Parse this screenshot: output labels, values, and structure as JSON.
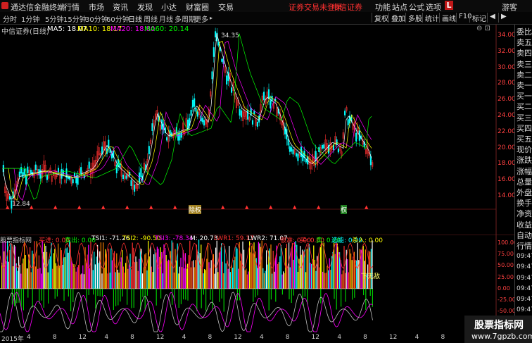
{
  "titlebar": {
    "app_name": "通达信金融终端",
    "menus": [
      "行情",
      "市场",
      "资讯",
      "发现",
      "小达",
      "财富圈",
      "交易"
    ],
    "notice": "证券交易未登录",
    "broker": "中信证券",
    "right_menus": [
      "功能",
      "站点",
      "公式",
      "选项"
    ],
    "l_badge": "L",
    "guest": "游客"
  },
  "periodbar": {
    "periods": [
      "分时",
      "1分钟",
      "5分钟",
      "15分钟",
      "30分钟",
      "60分钟",
      "日线",
      "周线",
      "月线",
      "多周期",
      "更多"
    ],
    "active": "日线",
    "right_buttons": [
      "复权",
      "叠加",
      "多股",
      "统计",
      "画线",
      "F10",
      "标记"
    ]
  },
  "chart": {
    "title": "中信证券(日线)",
    "ma": [
      {
        "label": "MA5: 18.07",
        "color": "#ffffff"
      },
      {
        "label": "MA10: 18.17",
        "color": "#ffff00"
      },
      {
        "label": "MA20: 18.80",
        "color": "#ff00ff"
      },
      {
        "label": "MA60: 20.14",
        "color": "#00ff00"
      }
    ],
    "high_label": "34.35",
    "low_label": "12.84",
    "yticks": [
      "34.00",
      "32.00",
      "30.00",
      "28.00",
      "26.00",
      "24.00",
      "22.00",
      "20.00",
      "18.00",
      "16.00",
      "14.00"
    ],
    "markers": [
      "除权",
      "权"
    ]
  },
  "indicator": {
    "name": "股票指标网",
    "values": [
      {
        "label": "买进: 0.00",
        "color": "#ff3030"
      },
      {
        "label": "卖出: 0.00",
        "color": "#00ff00"
      },
      {
        "label": "TSI1: -71.26",
        "color": "#ffffff"
      },
      {
        "label": "TSI2: -90.50",
        "color": "#ffff00"
      },
      {
        "label": "TSI3: -78.34",
        "color": "#ff00ff"
      },
      {
        "label": "M: 20.73",
        "color": "#ffffff"
      },
      {
        "label": "LWR1: 59.17",
        "color": "#ff3030"
      },
      {
        "label": "LWR2: 71.07",
        "color": "#ffffff"
      },
      {
        "label": "很准: 0.00",
        "color": "#ff3030"
      },
      {
        "label": "买: 0.00",
        "color": "#ff3030"
      },
      {
        "label": "卖: 0.00",
        "color": "#00ff00"
      },
      {
        "label": "选能: 0.00",
        "color": "#00ffff"
      },
      {
        "label": "杀入: 0.00",
        "color": "#ffff00"
      }
    ],
    "yticks": [
      "100.00",
      "75.00",
      "50.00",
      "25.00",
      "0.00",
      "-25.00",
      "-50.00",
      "-75.00"
    ],
    "annotation": "下无敌"
  },
  "datebar": {
    "year": "2015年",
    "ticks": [
      "4",
      "8",
      "12",
      "4",
      "8",
      "12",
      "4",
      "8",
      "12",
      "4",
      "8",
      "12",
      "4",
      "8",
      "12",
      "4",
      "8",
      "12",
      "4"
    ]
  },
  "sidebar": [
    "委比",
    "卖五",
    "卖四",
    "卖三",
    "卖二",
    "卖一",
    "买一",
    "买二",
    "买三",
    "买四",
    "买五",
    "现价",
    "涨跌",
    "涨幅",
    "总量",
    "外盘",
    "换手",
    "净资",
    "收益",
    "自动",
    "行情",
    "09:47",
    "09:47",
    "09:47",
    "09:47",
    "09:47",
    "09:47",
    "09:47"
  ],
  "watermark": {
    "name": "股票指标网",
    "url": "www.7gpzb.com"
  }
}
